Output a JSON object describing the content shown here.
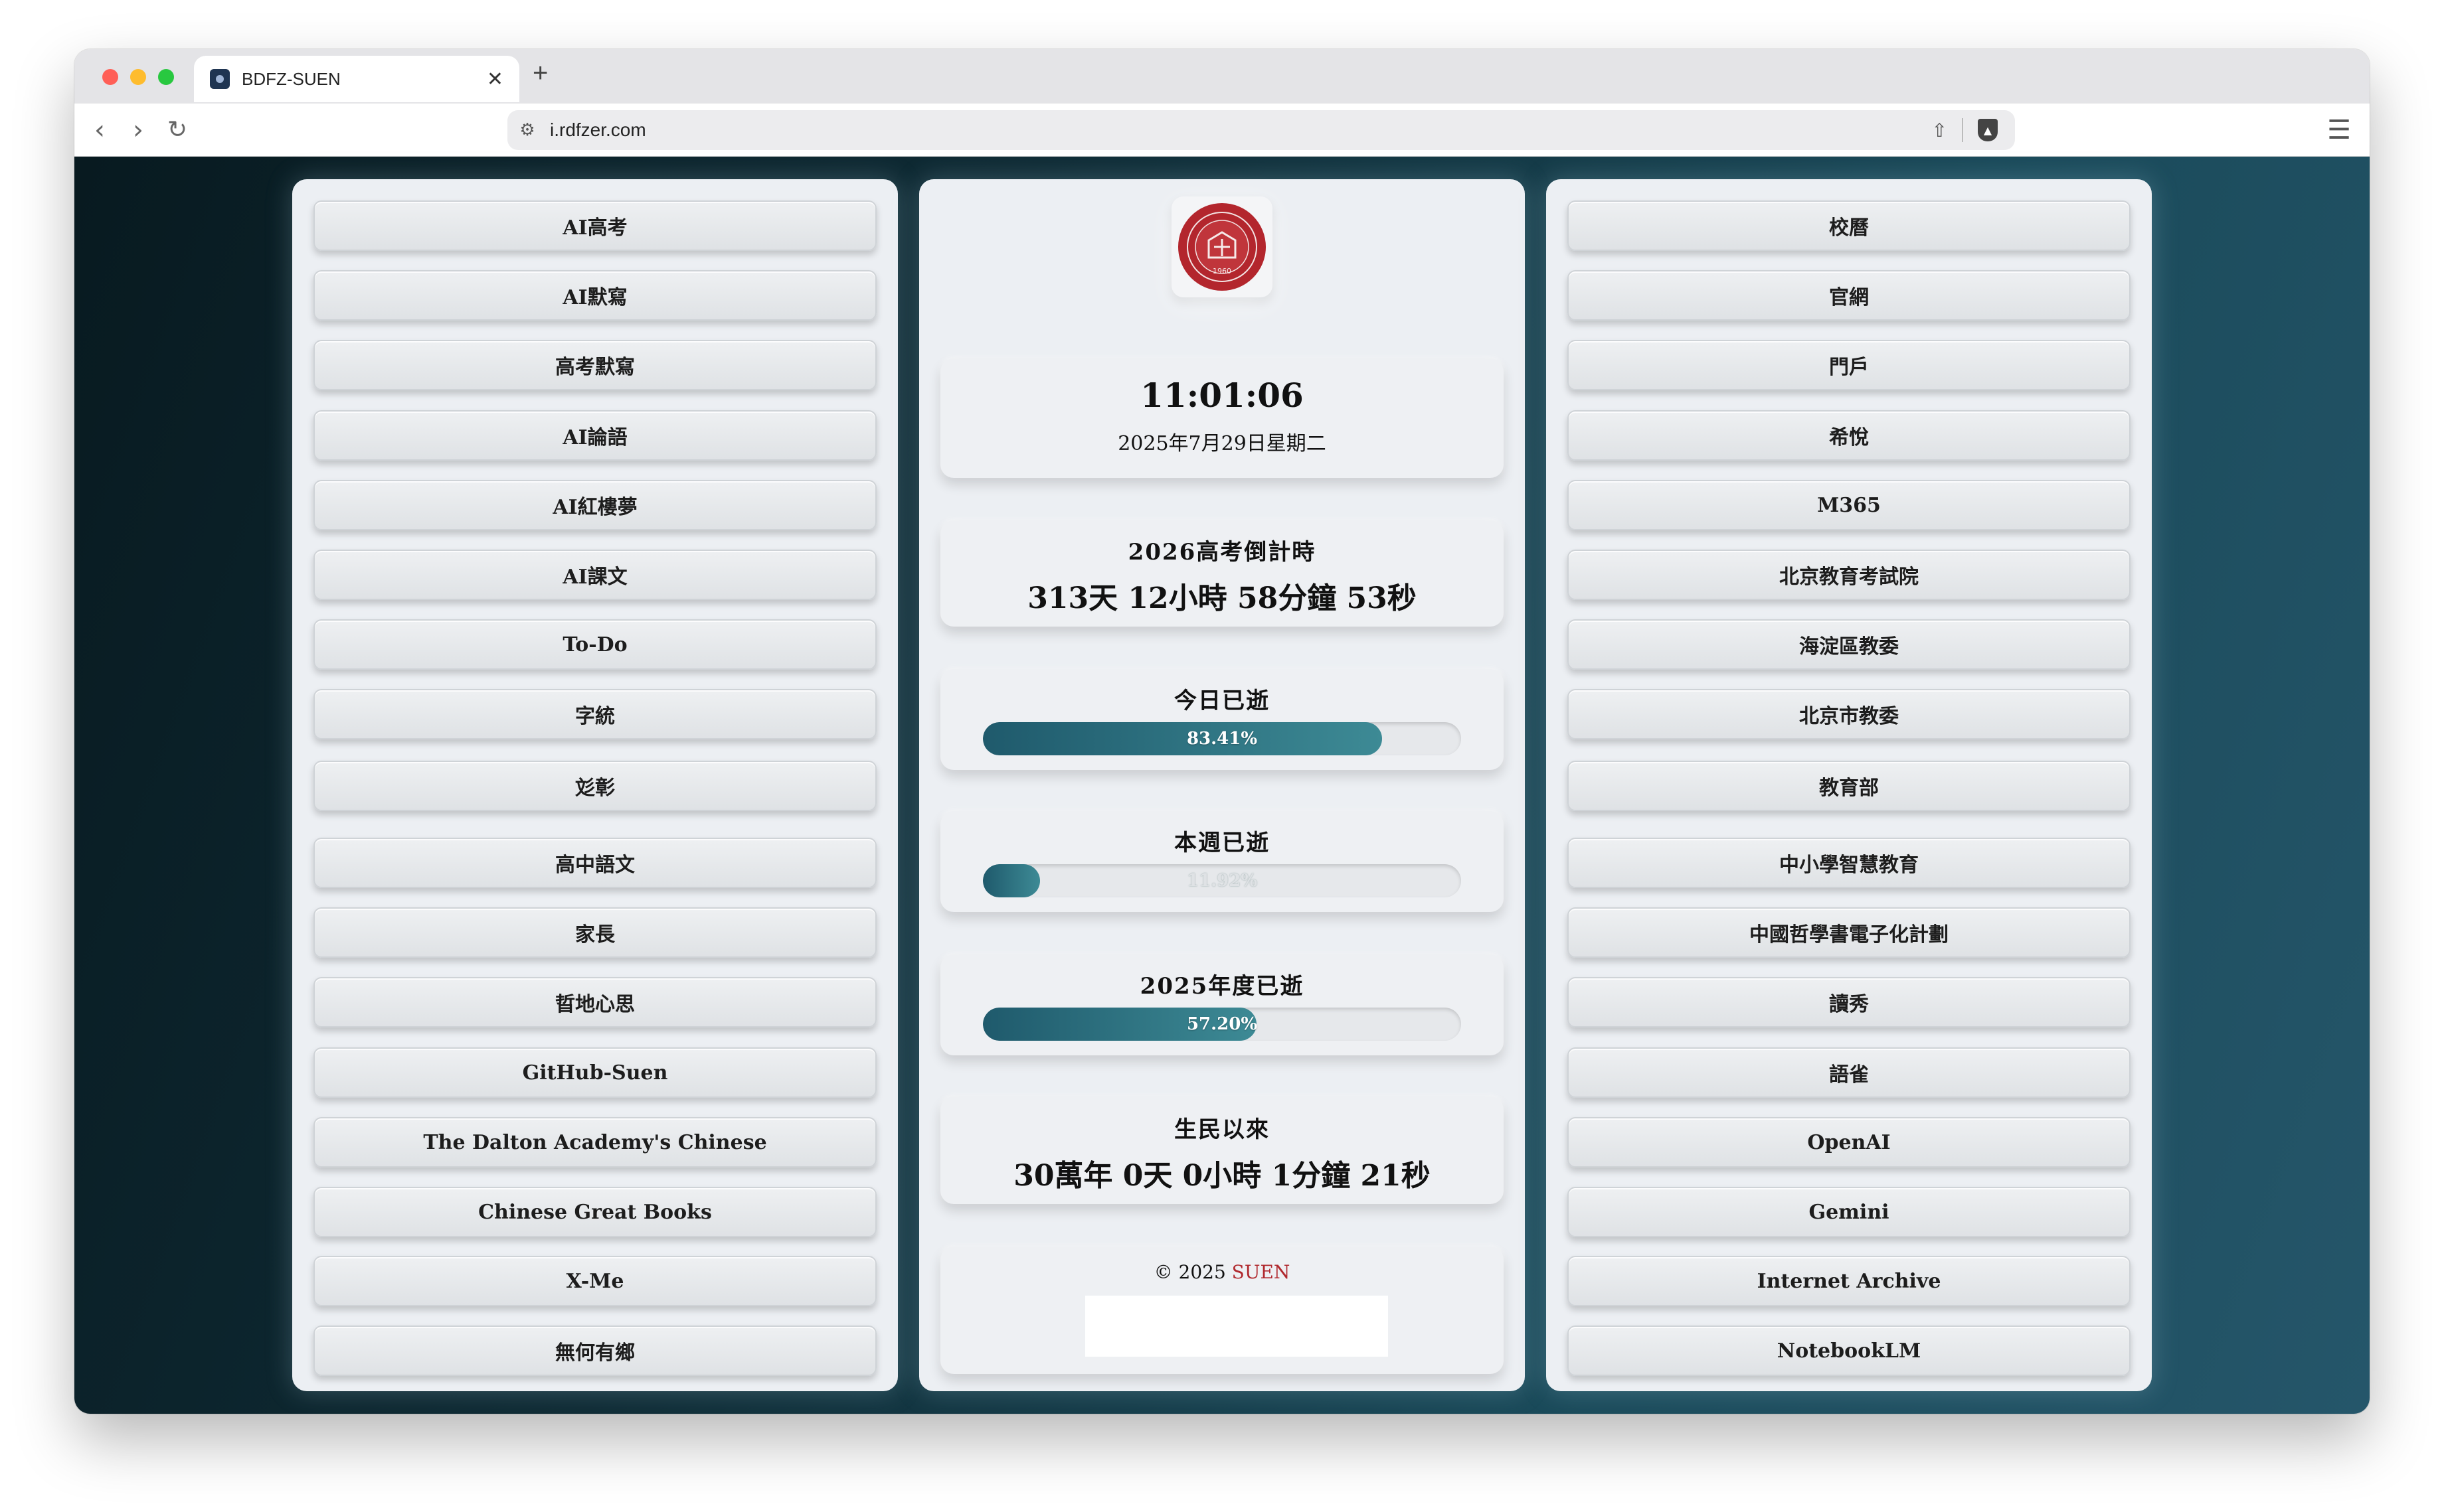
{
  "browser": {
    "tab_title": "BDFZ-SUEN",
    "tab_close": "✕",
    "new_tab": "+",
    "url": "i.rdfzer.com",
    "back": "‹",
    "forward": "›",
    "reload": "↻",
    "menu": "☰",
    "share": "⇧",
    "site_info": "⚙"
  },
  "left_links": [
    "AI高考",
    "AI默寫",
    "高考默寫",
    "AI論語",
    "AI紅樓夢",
    "AI課文",
    "To-Do",
    "字統",
    "彣彰",
    "高中語文",
    "家長",
    "晢地心思",
    "GitHub-Suen",
    "The Dalton Academy's Chinese",
    "Chinese Great Books",
    "X-Me",
    "無何有鄉"
  ],
  "right_links": [
    "校曆",
    "官網",
    "門戶",
    "希悅",
    "M365",
    "北京教育考試院",
    "海淀區教委",
    "北京市教委",
    "教育部",
    "中小學智慧教育",
    "中國哲學書電子化計劃",
    "讀秀",
    "語雀",
    "OpenAI",
    "Gemini",
    "Internet Archive",
    "NotebookLM"
  ],
  "clock": {
    "time": "11:01:06",
    "date": "2025年7月29日星期二"
  },
  "gaokao": {
    "title": "2026高考倒計時",
    "value": "313天 12小時 58分鐘 53秒"
  },
  "day_progress": {
    "title": "今日已逝",
    "percent": 83.41,
    "label": "83.41%"
  },
  "week_progress": {
    "title": "本週已逝",
    "percent": 11.92,
    "label": "11.92%"
  },
  "year_progress": {
    "title": "2025年度已逝",
    "percent": 57.2,
    "label": "57.20%"
  },
  "since_birth": {
    "title": "生民以來",
    "value": "30萬年 0天 0小時 1分鐘 21秒"
  },
  "footer": {
    "copyright": "© 2025 ",
    "author": "SUEN"
  },
  "logo": {
    "seal_text": "1960"
  }
}
